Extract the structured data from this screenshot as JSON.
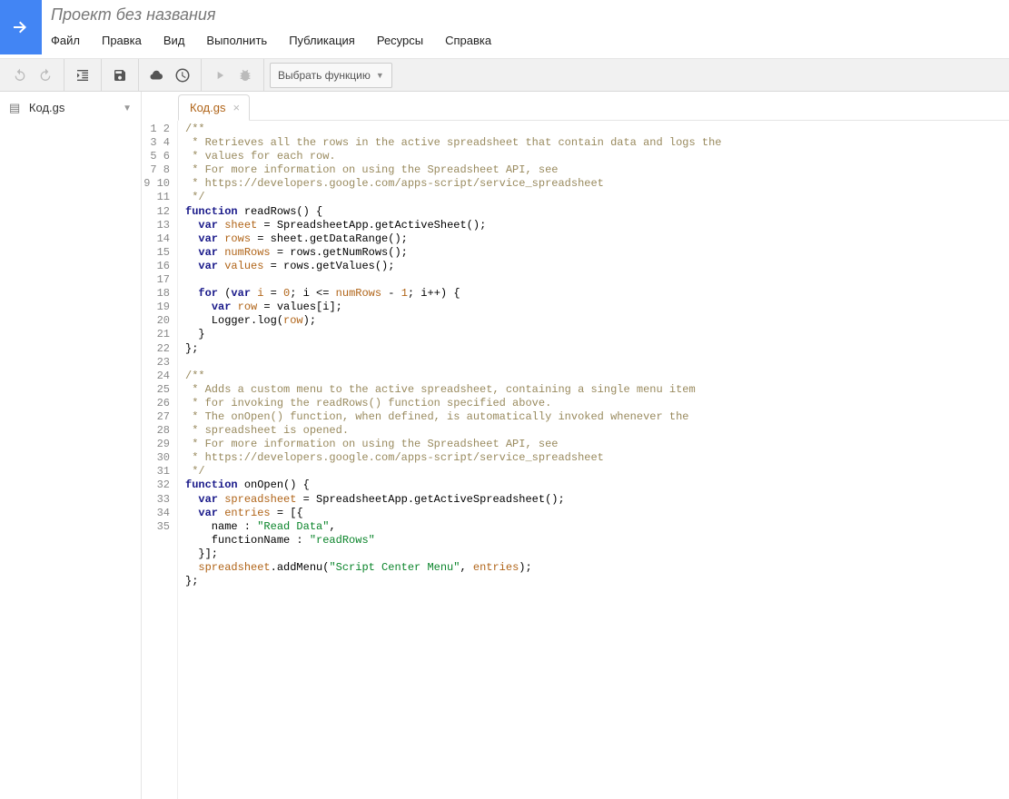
{
  "header": {
    "title": "Проект без названия",
    "menu": [
      "Файл",
      "Правка",
      "Вид",
      "Выполнить",
      "Публикация",
      "Ресурсы",
      "Справка"
    ]
  },
  "toolbar": {
    "func_select": "Выбрать функцию"
  },
  "sidebar": {
    "file_name": "Код.gs"
  },
  "tabs": {
    "active": "Код.gs"
  },
  "code": {
    "lines": [
      [
        {
          "c": "c-comment",
          "t": "/**"
        }
      ],
      [
        {
          "c": "c-comment",
          "t": " * Retrieves all the rows in the active spreadsheet that contain data and logs the"
        }
      ],
      [
        {
          "c": "c-comment",
          "t": " * values for each row."
        }
      ],
      [
        {
          "c": "c-comment",
          "t": " * For more information on using the Spreadsheet API, see"
        }
      ],
      [
        {
          "c": "c-comment",
          "t": " * https://developers.google.com/apps-script/service_spreadsheet"
        }
      ],
      [
        {
          "c": "c-comment",
          "t": " */"
        }
      ],
      [
        {
          "c": "c-kw",
          "t": "function"
        },
        {
          "c": "c-plain",
          "t": " "
        },
        {
          "c": "c-func",
          "t": "readRows"
        },
        {
          "c": "c-plain",
          "t": "() {"
        }
      ],
      [
        {
          "c": "c-plain",
          "t": "  "
        },
        {
          "c": "c-kw",
          "t": "var"
        },
        {
          "c": "c-plain",
          "t": " "
        },
        {
          "c": "c-ident",
          "t": "sheet"
        },
        {
          "c": "c-plain",
          "t": " = SpreadsheetApp.getActiveSheet();"
        }
      ],
      [
        {
          "c": "c-plain",
          "t": "  "
        },
        {
          "c": "c-kw",
          "t": "var"
        },
        {
          "c": "c-plain",
          "t": " "
        },
        {
          "c": "c-ident",
          "t": "rows"
        },
        {
          "c": "c-plain",
          "t": " = sheet.getDataRange();"
        }
      ],
      [
        {
          "c": "c-plain",
          "t": "  "
        },
        {
          "c": "c-kw",
          "t": "var"
        },
        {
          "c": "c-plain",
          "t": " "
        },
        {
          "c": "c-ident",
          "t": "numRows"
        },
        {
          "c": "c-plain",
          "t": " = rows.getNumRows();"
        }
      ],
      [
        {
          "c": "c-plain",
          "t": "  "
        },
        {
          "c": "c-kw",
          "t": "var"
        },
        {
          "c": "c-plain",
          "t": " "
        },
        {
          "c": "c-ident",
          "t": "values"
        },
        {
          "c": "c-plain",
          "t": " = rows.getValues();"
        }
      ],
      [
        {
          "c": "c-plain",
          "t": ""
        }
      ],
      [
        {
          "c": "c-plain",
          "t": "  "
        },
        {
          "c": "c-kw",
          "t": "for"
        },
        {
          "c": "c-plain",
          "t": " ("
        },
        {
          "c": "c-kw",
          "t": "var"
        },
        {
          "c": "c-plain",
          "t": " "
        },
        {
          "c": "c-ident",
          "t": "i"
        },
        {
          "c": "c-plain",
          "t": " = "
        },
        {
          "c": "c-num",
          "t": "0"
        },
        {
          "c": "c-plain",
          "t": "; i <= "
        },
        {
          "c": "c-ident",
          "t": "numRows"
        },
        {
          "c": "c-plain",
          "t": " - "
        },
        {
          "c": "c-num",
          "t": "1"
        },
        {
          "c": "c-plain",
          "t": "; i++) {"
        }
      ],
      [
        {
          "c": "c-plain",
          "t": "    "
        },
        {
          "c": "c-kw",
          "t": "var"
        },
        {
          "c": "c-plain",
          "t": " "
        },
        {
          "c": "c-ident",
          "t": "row"
        },
        {
          "c": "c-plain",
          "t": " = values[i];"
        }
      ],
      [
        {
          "c": "c-plain",
          "t": "    Logger.log("
        },
        {
          "c": "c-ident",
          "t": "row"
        },
        {
          "c": "c-plain",
          "t": ");"
        }
      ],
      [
        {
          "c": "c-plain",
          "t": "  }"
        }
      ],
      [
        {
          "c": "c-plain",
          "t": "};"
        }
      ],
      [
        {
          "c": "c-plain",
          "t": ""
        }
      ],
      [
        {
          "c": "c-comment",
          "t": "/**"
        }
      ],
      [
        {
          "c": "c-comment",
          "t": " * Adds a custom menu to the active spreadsheet, containing a single menu item"
        }
      ],
      [
        {
          "c": "c-comment",
          "t": " * for invoking the readRows() function specified above."
        }
      ],
      [
        {
          "c": "c-comment",
          "t": " * The onOpen() function, when defined, is automatically invoked whenever the"
        }
      ],
      [
        {
          "c": "c-comment",
          "t": " * spreadsheet is opened."
        }
      ],
      [
        {
          "c": "c-comment",
          "t": " * For more information on using the Spreadsheet API, see"
        }
      ],
      [
        {
          "c": "c-comment",
          "t": " * https://developers.google.com/apps-script/service_spreadsheet"
        }
      ],
      [
        {
          "c": "c-comment",
          "t": " */"
        }
      ],
      [
        {
          "c": "c-kw",
          "t": "function"
        },
        {
          "c": "c-plain",
          "t": " "
        },
        {
          "c": "c-func",
          "t": "onOpen"
        },
        {
          "c": "c-plain",
          "t": "() {"
        }
      ],
      [
        {
          "c": "c-plain",
          "t": "  "
        },
        {
          "c": "c-kw",
          "t": "var"
        },
        {
          "c": "c-plain",
          "t": " "
        },
        {
          "c": "c-ident",
          "t": "spreadsheet"
        },
        {
          "c": "c-plain",
          "t": " = SpreadsheetApp.getActiveSpreadsheet();"
        }
      ],
      [
        {
          "c": "c-plain",
          "t": "  "
        },
        {
          "c": "c-kw",
          "t": "var"
        },
        {
          "c": "c-plain",
          "t": " "
        },
        {
          "c": "c-ident",
          "t": "entries"
        },
        {
          "c": "c-plain",
          "t": " = [{"
        }
      ],
      [
        {
          "c": "c-plain",
          "t": "    name : "
        },
        {
          "c": "c-str",
          "t": "\"Read Data\""
        },
        {
          "c": "c-plain",
          "t": ","
        }
      ],
      [
        {
          "c": "c-plain",
          "t": "    functionName : "
        },
        {
          "c": "c-str",
          "t": "\"readRows\""
        }
      ],
      [
        {
          "c": "c-plain",
          "t": "  }];"
        }
      ],
      [
        {
          "c": "c-plain",
          "t": "  "
        },
        {
          "c": "c-ident",
          "t": "spreadsheet"
        },
        {
          "c": "c-plain",
          "t": ".addMenu("
        },
        {
          "c": "c-str",
          "t": "\"Script Center Menu\""
        },
        {
          "c": "c-plain",
          "t": ", "
        },
        {
          "c": "c-ident",
          "t": "entries"
        },
        {
          "c": "c-plain",
          "t": ");"
        }
      ],
      [
        {
          "c": "c-plain",
          "t": "};"
        }
      ],
      [
        {
          "c": "c-plain",
          "t": ""
        }
      ]
    ]
  }
}
